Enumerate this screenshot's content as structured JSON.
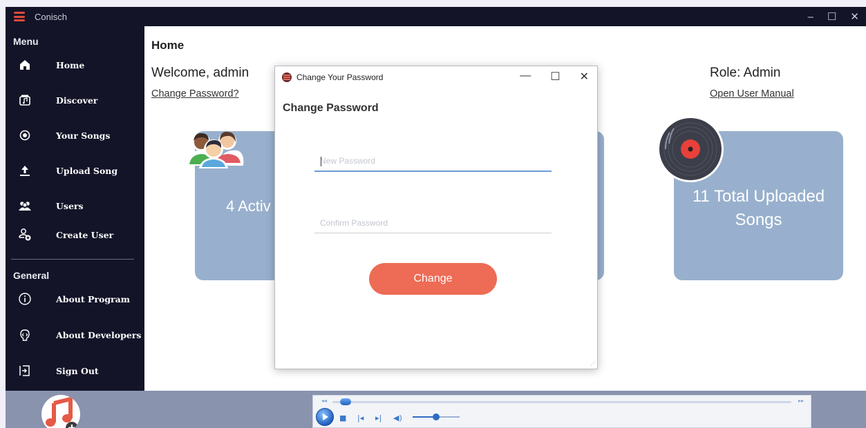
{
  "window": {
    "title": "Conisch",
    "controls": {
      "minimize": "–",
      "maximize": "☐",
      "close": "✕"
    }
  },
  "sidebar": {
    "menu_header": "Menu",
    "general_header": "General",
    "menu_items": [
      {
        "label": "Home",
        "icon": "home-icon"
      },
      {
        "label": "Discover",
        "icon": "music-folder-icon"
      },
      {
        "label": "Your Songs",
        "icon": "record-icon"
      },
      {
        "label": "Upload Song",
        "icon": "upload-icon"
      },
      {
        "label": "Users",
        "icon": "users-icon"
      },
      {
        "label": "Create User",
        "icon": "add-user-icon"
      }
    ],
    "general_items": [
      {
        "label": "About Program",
        "icon": "info-icon"
      },
      {
        "label": "About Developers",
        "icon": "developer-icon"
      },
      {
        "label": "Sign Out",
        "icon": "sign-out-icon"
      }
    ]
  },
  "main": {
    "title": "Home",
    "welcome": "Welcome, admin",
    "change_password_link": "Change Password?",
    "role": "Role: Admin",
    "manual_link": "Open User Manual",
    "users_card_text": "4 Activ",
    "songs_card_text": "11 Total Uploaded Songs"
  },
  "dialog": {
    "title": "Change Your Password",
    "controls": {
      "minimize": "—",
      "maximize": "☐",
      "close": "✕"
    },
    "heading": "Change Password",
    "new_password_placeholder": "New Password",
    "confirm_password_placeholder": "Confirm Password",
    "button_label": "Change"
  },
  "player": {
    "seek_position": 0.02,
    "volume": 0.5
  },
  "colors": {
    "sidebar_bg": "#131428",
    "card_bg": "#98b0cd",
    "accent_button": "#ee6b55",
    "bottom_bar": "#8993ae",
    "logo_red": "#e04a3a"
  }
}
